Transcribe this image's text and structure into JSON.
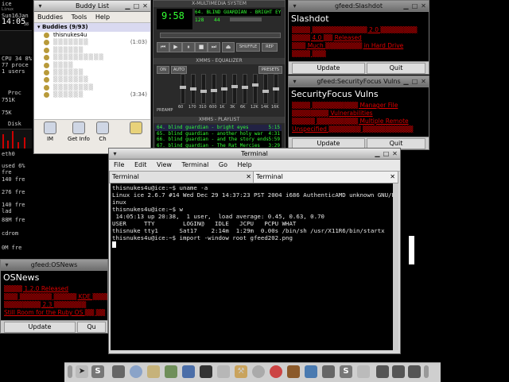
{
  "colors": {
    "desktop": "#000000",
    "feed_link": "#dd0000",
    "lcd_green": "#33ff33",
    "selection_red": "#cc0000"
  },
  "sysmon": {
    "hostname": "ice",
    "host_sub": "Linux",
    "date": "Sun16Jan",
    "time": "14:05",
    "time_sub": "38",
    "cpu": "CPU 34 8%",
    "procs": "77 proce",
    "users": "1 users",
    "proc_label": "Proc",
    "mem_751k": "751K",
    "mem_75k": "75K",
    "disk_label": "Disk",
    "eth0": "eth0",
    "used": "used 6% fre",
    "fre1": "140 fre",
    "fre2": "276 fre",
    "fre3": "140 fre",
    "lad": "lad",
    "fre4": "88M fre",
    "cdrom": "cdrom",
    "fre5": "0M fre"
  },
  "buddy": {
    "title": "Buddy List",
    "menu": [
      "Buddies",
      "Tools",
      "Help"
    ],
    "group": "Buddies (9/93)",
    "buddies": [
      {
        "name": "thisnukes4u",
        "idle": ""
      },
      {
        "name": "▒▒▒▒▒▒▒",
        "idle": "(1:03)"
      },
      {
        "name": "▒▒▒▒▒▒",
        "idle": ""
      },
      {
        "name": "▒▒▒▒▒▒▒▒▒▒",
        "idle": ""
      },
      {
        "name": "▒▒▒▒",
        "idle": ""
      },
      {
        "name": "▒▒▒▒▒▒",
        "idle": ""
      },
      {
        "name": "▒▒▒▒▒▒▒",
        "idle": ""
      },
      {
        "name": "▒▒▒▒▒▒▒▒",
        "idle": ""
      },
      {
        "name": "▒▒▒▒▒▒",
        "idle": "(3:34)"
      }
    ],
    "actions": {
      "im": "IM",
      "get_info": "Get Info",
      "chat": "Ch"
    }
  },
  "xmms": {
    "title": "XMMS",
    "main_title": "X-MULTIMEDIA SYSTEM",
    "time": "9:58",
    "track": "64. BLIND GUARDIAN - BRIGHT EYES",
    "kbps": "128",
    "khz": "44",
    "shuffle": "SHUFFLE",
    "rep": "REP",
    "eq_title": "XMMS - EQUALIZER",
    "eq_on": "ON",
    "eq_auto": "AUTO",
    "eq_presets": "PRESETS",
    "eq_preamp": "PREAMP",
    "eq_bands": [
      "60",
      "170",
      "310",
      "600",
      "1K",
      "3K",
      "6K",
      "12K",
      "14K",
      "16K"
    ],
    "eq_levels": [
      0.45,
      0.5,
      0.6,
      0.55,
      0.5,
      0.4,
      0.45,
      0.35,
      0.6,
      0.5
    ],
    "pl_title": "XMMS - PLAYLIST",
    "playlist": [
      {
        "title": "64. blind guardian - bright eyes",
        "time": "5:15"
      },
      {
        "title": "65. blind guardian - another holy war",
        "time": "4:31"
      },
      {
        "title": "66. blind guardian - and the story ends",
        "time": "5:59"
      },
      {
        "title": "67. blind guardian - The Rat Mercies",
        "time": "3:29"
      }
    ]
  },
  "slashdot": {
    "title": "gfeed:Slashdot",
    "head": "Slashdot",
    "items": [
      "▒▒▒▒ ▒▒▒▒▒▒▒▒▒▒▒▒ 2.0 ▒▒▒▒▒▒▒▒",
      "▒▒▒▒ 4.0 ▒▒ Released",
      "▒▒▒ Much ▒▒▒▒▒▒▒▒ in Hard Drive",
      "▒▒▒▒ ▒▒▒"
    ],
    "update": "Update",
    "quit": "Quit"
  },
  "securityfocus": {
    "title": "gfeed:SecurityFocus Vulns",
    "head": "SecurityFocus Vulns",
    "items": [
      "▒▒▒▒ ▒▒▒▒▒▒▒▒▒▒ Manager File",
      "▒▒▒▒▒▒▒▒ Vulnerabilities",
      "▒▒▒▒▒ ▒▒▒▒▒▒▒▒▒ Multiple Remote",
      "Unspecified ▒▒▒▒▒▒▒ ▒▒▒▒▒▒▒▒▒▒▒"
    ],
    "update": "Update",
    "quit": "Quit"
  },
  "osnews": {
    "title": "gfeed:OSNews",
    "head": "OSNews",
    "items": [
      "▒▒▒▒ 1.2.0 Released",
      "▒▒▒ ▒▒▒▒▒▒▒ ▒▒▒▒▒ KDE ▒▒▒▒▒▒▒▒",
      "▒▒▒▒▒▒▒▒ 2.3 ▒▒▒▒▒▒▒",
      "Still Room for the Ruby OS ▒▒ ▒▒"
    ],
    "update": "Update",
    "quit": "Qu"
  },
  "terminal": {
    "title": "Terminal",
    "menu": [
      "File",
      "Edit",
      "View",
      "Terminal",
      "Go",
      "Help"
    ],
    "tabs": [
      "Terminal",
      "Terminal"
    ],
    "lines": [
      "thisnukes4u@ice:~$ uname -a",
      "Linux ice 2.6.7 #14 Wed Dec 29 14:37:23 PST 2004 i686 AuthenticAMD unknown GNU/L",
      "inux",
      "thisnukes4u@ice:~$ w",
      " 14:05:13 up 20:38,  1 user,  load average: 0.45, 0.63, 0.70",
      "USER     TTY        LOGIN@   IDLE   JCPU   PCPU WHAT",
      "thisnuke tty1      Sat17    2:14m  1:29m  0.00s /bin/sh /usr/X11R6/bin/startx",
      "thisnukes4u@ice:~$ import -window root gfeed202.png"
    ]
  }
}
